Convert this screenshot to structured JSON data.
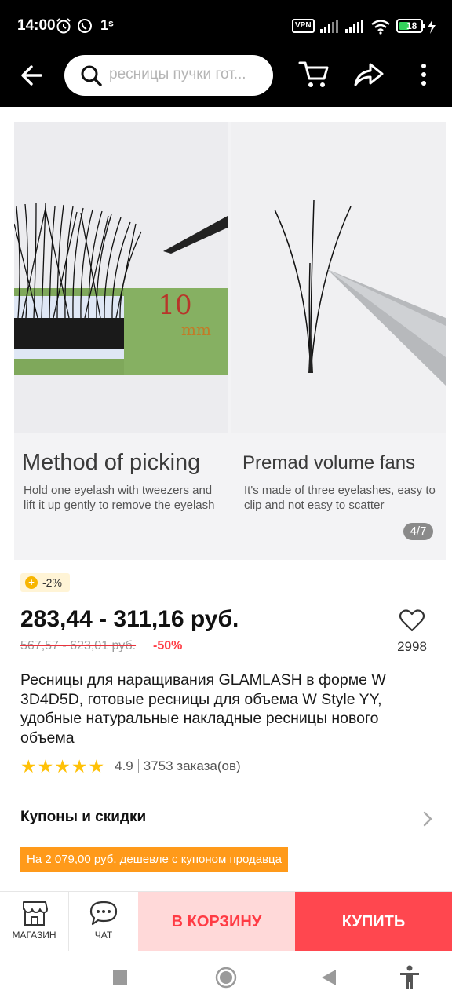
{
  "status_bar": {
    "time": "14:00",
    "vpn": "VPN",
    "battery": "18",
    "superscript": "1ˢ"
  },
  "header": {
    "search_placeholder": "ресницы пучки гот..."
  },
  "gallery": {
    "left_panel": {
      "title": "Method of picking",
      "subtitle_line1": "Hold one eyelash with tweezers and",
      "subtitle_line2": "lift it up gently to remove the eyelash",
      "ruler_text": "10",
      "ruler_unit": "mm"
    },
    "right_panel": {
      "title": "Premad volume fans",
      "subtitle_line1": "It's made of three eyelashes, easy to",
      "subtitle_line2": "clip and not easy to scatter"
    },
    "counter": "4/7"
  },
  "product": {
    "coin_badge": "-2%",
    "price": "283,44 - 311,16 руб.",
    "old_price": "567,57 - 623,01 руб.",
    "discount": "-50%",
    "favorites": "2998",
    "title": "Ресницы для наращивания GLAMLASH в форме W 3D4D5D, готовые ресницы для объема W Style YY, удобные натуральные накладные ресницы нового объема",
    "rating": 4.9,
    "rating_text": "4.9",
    "orders": "3753 заказа(ов)"
  },
  "coupons": {
    "label": "Купоны и скидки",
    "tag": "На 2 079,00 руб. дешевле с купоном продавца"
  },
  "bottom_bar": {
    "store_label": "МАГАЗИН",
    "chat_label": "ЧАТ",
    "add_to_cart": "В КОРЗИНУ",
    "buy": "КУПИТЬ"
  },
  "colors": {
    "accent_red": "#ff474f",
    "cart_bg": "#ffd9d9",
    "coupon_orange": "#ff9a1a",
    "star_yellow": "#ffc107"
  },
  "icons": [
    "back-arrow-icon",
    "search-icon",
    "cart-icon",
    "share-icon",
    "more-vertical-icon",
    "heart-icon",
    "store-icon",
    "chat-icon",
    "chevron-right-icon",
    "coin-icon"
  ]
}
